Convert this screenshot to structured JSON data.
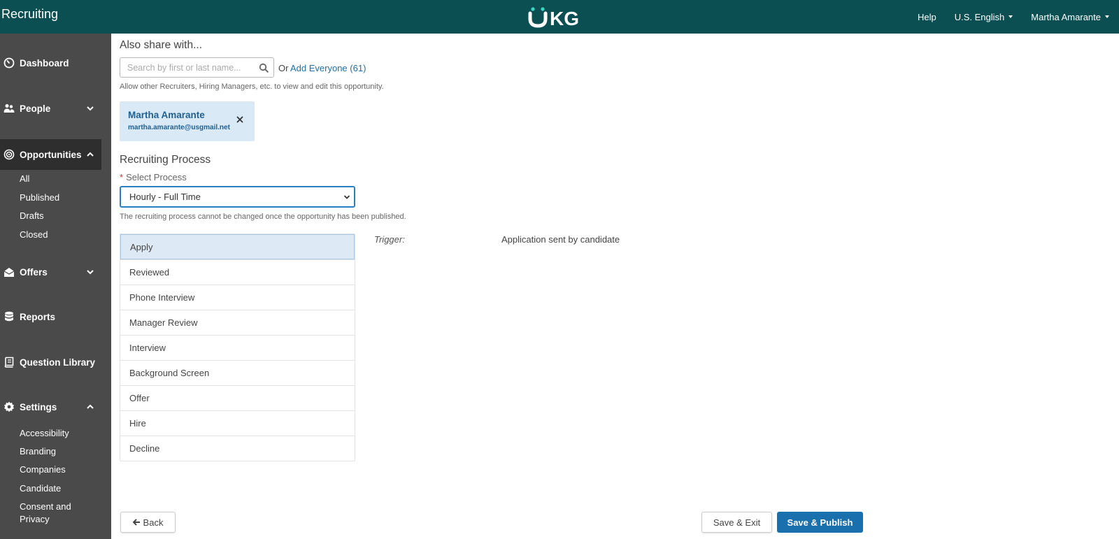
{
  "header": {
    "app_title": "Recruiting",
    "logo_text": "UKG",
    "help": "Help",
    "language": "U.S. English",
    "user": "Martha Amarante"
  },
  "colors": {
    "header_bg": "#0b4f52",
    "sidebar_bg": "#4a4a4a",
    "sidebar_active_bg": "#2e2e2e",
    "primary": "#1a6fad",
    "chip_bg": "#d9e9f6",
    "step_active_bg": "#dde9f5"
  },
  "sidebar": {
    "dashboard": "Dashboard",
    "people": "People",
    "opportunities": "Opportunities",
    "opportunities_sub": [
      "All",
      "Published",
      "Drafts",
      "Closed"
    ],
    "offers": "Offers",
    "reports": "Reports",
    "question_library": "Question Library",
    "settings": "Settings",
    "settings_sub": [
      "Accessibility",
      "Branding",
      "Companies",
      "Candidate",
      "Consent and",
      "Privacy"
    ]
  },
  "share": {
    "heading": "Also share with...",
    "search_placeholder": "Search by first or last name...",
    "or": "Or",
    "add_everyone": "Add Everyone (61)",
    "help_text": "Allow other Recruiters, Hiring Managers, etc. to view and edit this opportunity.",
    "chip": {
      "name": "Martha Amarante",
      "email": "martha.amarante@usgmail.net"
    }
  },
  "process": {
    "heading": "Recruiting Process",
    "required_marker": "*",
    "select_label": "Select Process",
    "selected": "Hourly - Full Time",
    "note": "The recruiting process cannot be changed once the opportunity has been published.",
    "steps": [
      "Apply",
      "Reviewed",
      "Phone Interview",
      "Manager Review",
      "Interview",
      "Background Screen",
      "Offer",
      "Hire",
      "Decline"
    ],
    "active_step": "Apply",
    "trigger_label": "Trigger:",
    "trigger_value": "Application sent by candidate"
  },
  "footer": {
    "back": "Back",
    "save_exit": "Save & Exit",
    "save_publish": "Save & Publish"
  }
}
